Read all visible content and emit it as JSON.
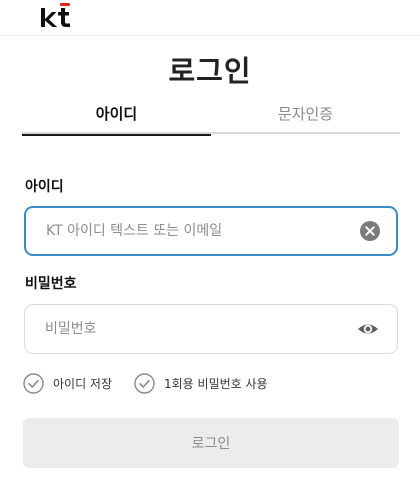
{
  "header": {
    "logo_text": "kt"
  },
  "page": {
    "title": "로그인"
  },
  "tabs": [
    {
      "label": "아이디",
      "active": true
    },
    {
      "label": "문자인증",
      "active": false
    }
  ],
  "id_field": {
    "label": "아이디",
    "value": "",
    "placeholder": "KT 아이디 텍스트 또는 이메일",
    "icon": "clear-icon"
  },
  "password_field": {
    "label": "비밀번호",
    "value": "",
    "placeholder": "비밀번호",
    "icon": "eye-icon"
  },
  "options": [
    {
      "label": "아이디 저장",
      "checked": false
    },
    {
      "label": "1회용 비밀번호 사용",
      "checked": false
    }
  ],
  "login_button": {
    "label": "로그인"
  },
  "colors": {
    "focus_border": "#3a8bc4",
    "brand_red": "#e2231a",
    "button_bg": "#ececec"
  }
}
